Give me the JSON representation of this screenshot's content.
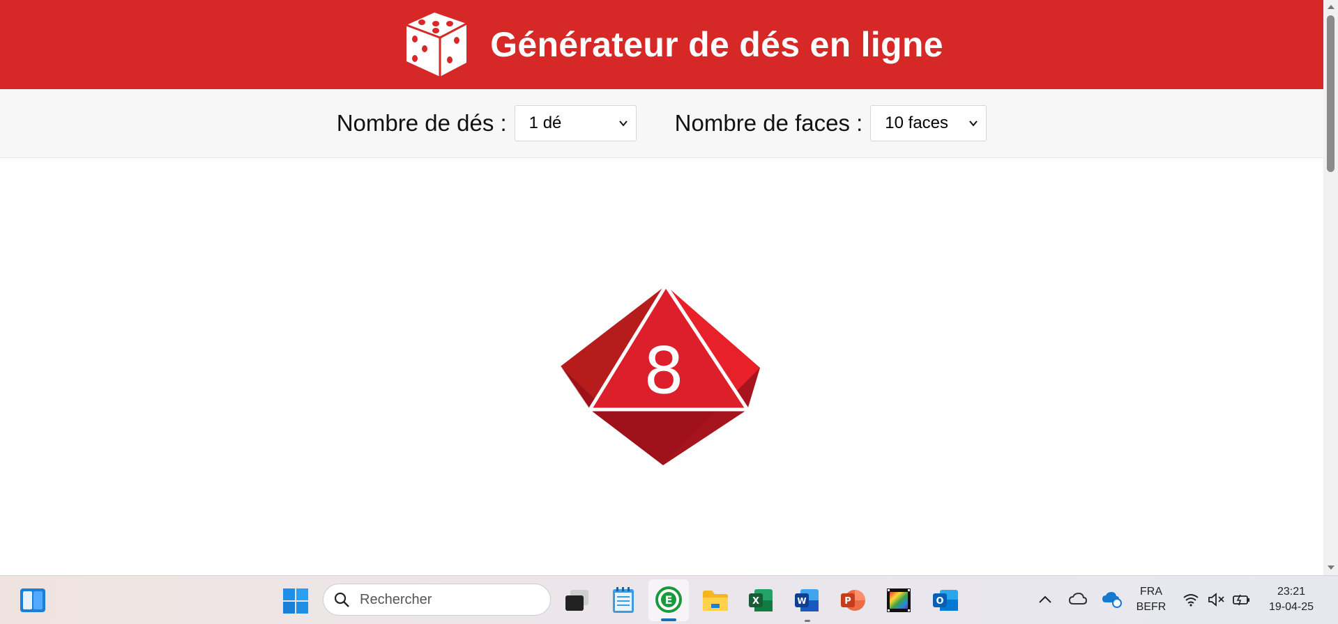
{
  "header": {
    "title": "Générateur de dés en ligne",
    "logo_icon": "dice-logo-icon"
  },
  "controls": {
    "dice_count_label": "Nombre de dés :",
    "dice_count_value": "1 dé",
    "faces_label": "Nombre de faces :",
    "faces_value": "10 faces"
  },
  "die": {
    "value": "8",
    "color": "#d72828",
    "shape": "d10"
  },
  "taskbar": {
    "search_placeholder": "Rechercher",
    "language_line1": "FRA",
    "language_line2": "BEFR",
    "time": "23:21",
    "date": "19-04-25",
    "apps": [
      "widgets-icon",
      "start-icon",
      "task-view-icon",
      "notepad-icon",
      "e-app-icon",
      "file-explorer-icon",
      "excel-icon",
      "word-icon",
      "powerpoint-icon",
      "photos-icon",
      "outlook-icon"
    ],
    "tray": [
      "chevron-up-icon",
      "cloud-icon",
      "onedrive-sync-icon",
      "wifi-icon",
      "volume-muted-icon",
      "battery-icon"
    ]
  },
  "colors": {
    "header_bg": "#d72828",
    "controls_bg": "#f7f7f7"
  }
}
